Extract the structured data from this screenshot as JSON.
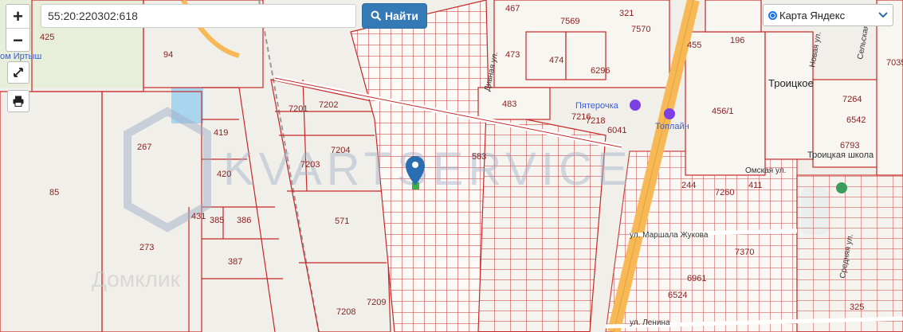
{
  "search": {
    "value": "55:20:220302:618",
    "button_label": "Найти"
  },
  "zoom": {
    "in_label": "+",
    "out_label": "−"
  },
  "layer_select": {
    "selected": "Карта Яндекс"
  },
  "watermark": {
    "text": "KVARTSERVICE",
    "brand2": "Домклик"
  },
  "parcels": [
    "425",
    "94",
    "467",
    "7569",
    "7570",
    "321",
    "196",
    "455",
    "473",
    "474",
    "6296",
    "483",
    "7201",
    "7202",
    "7204",
    "7203",
    "583",
    "419",
    "267",
    "420",
    "85",
    "571",
    "431",
    "385",
    "386",
    "273",
    "387",
    "7209",
    "7208",
    "7216",
    "7218",
    "6041",
    "456/1",
    "7264",
    "7035",
    "6542",
    "6793",
    "244",
    "7260",
    "411",
    "7370",
    "6961",
    "6524",
    "325"
  ],
  "streets": [
    "Дивная ул.",
    "Омская ул.",
    "ул. Маршала Жукова",
    "ул. Ленина",
    "Средняя ул.",
    "Новая ул.",
    "Сельская ул."
  ],
  "pois": [
    "Пятерочка",
    "Топлайн",
    "Троицкая школа",
    "ом Иртыш"
  ],
  "places": [
    "Троицкое"
  ],
  "colors": {
    "parcel_line": "#c62828",
    "road": "#f7b955",
    "primary_button": "#337ab7",
    "marker": "#2a6db0",
    "accent": "#1a73e8"
  }
}
